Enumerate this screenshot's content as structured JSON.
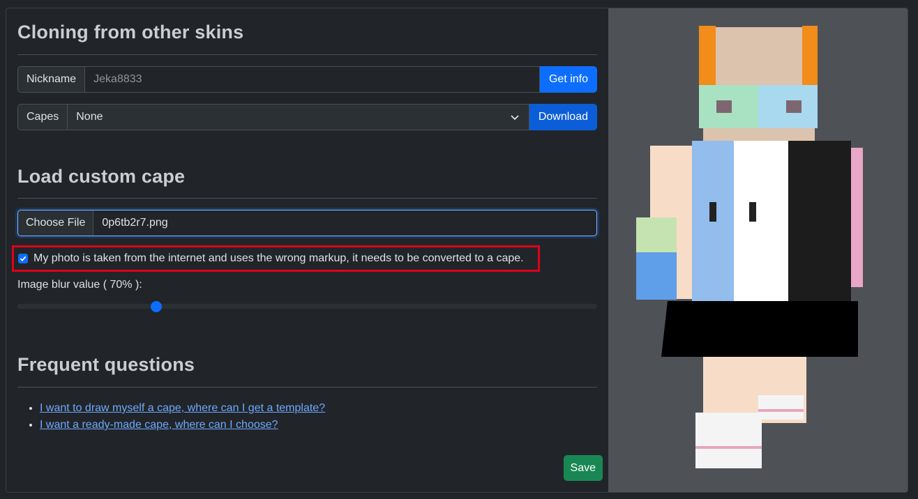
{
  "clone": {
    "title": "Cloning from other skins",
    "nickname_label": "Nickname",
    "nickname_value": "Jeka8833",
    "get_info": "Get info",
    "capes_label": "Capes",
    "capes_selected": "None",
    "download": "Download"
  },
  "load": {
    "title": "Load custom cape",
    "choose_file": "Choose File",
    "file_name": "0p6tb2r7.png",
    "checkbox_label": "My photo is taken from the internet and uses the wrong markup, it needs to be converted to a cape.",
    "checkbox_checked": true,
    "blur_label": "Image blur value ( 70% ):",
    "blur_fraction": 0.24
  },
  "faq": {
    "title": "Frequent questions",
    "links": [
      "I want to draw myself a cape, where can I get a template?",
      "I want a ready-made cape, where can I choose?"
    ]
  },
  "save": "Save",
  "colors": {
    "accent": "#0d6efd",
    "save": "#198754",
    "highlight": "#e0001a"
  }
}
